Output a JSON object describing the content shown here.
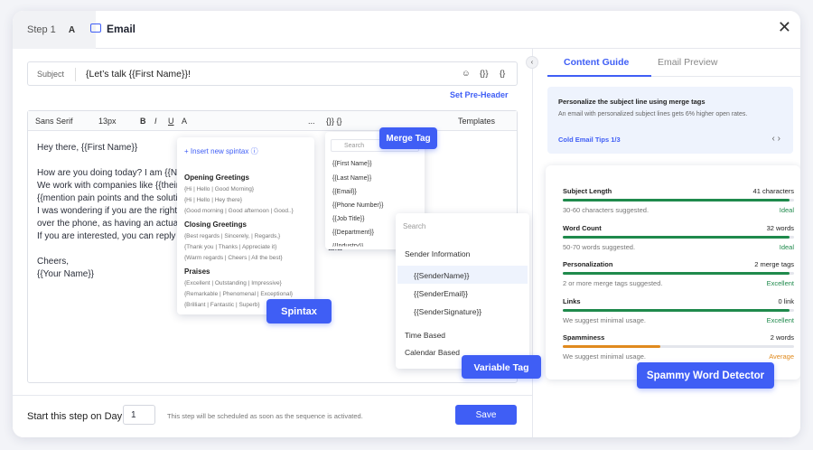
{
  "header": {
    "step": "Step 1",
    "variant": "A",
    "title": "Email",
    "close": "✕"
  },
  "subject": {
    "label": "Subject",
    "value": "{Let’s talk {{First Name}}!",
    "icons": [
      "☺",
      "{}}",
      "{}"
    ]
  },
  "preheader": "Set Pre-Header",
  "toolbar": {
    "font": "Sans Serif",
    "size": "13px",
    "bold": "B",
    "italic": "I",
    "underline": "U",
    "color": "A",
    "more": "...",
    "vars": "{}}  {}",
    "templates": "Templates"
  },
  "body": {
    "l1": "Hey there, {{First Name}}",
    "l2": "How are you doing today? I am {{Nar",
    "l3": "We work with companies like {{their c",
    "l4": "{{mention pain points and the solutio",
    "l5": "I was wondering if you are the right p",
    "l6": "over the phone, as having an actual c",
    "l7": "If you are interested, you can reply to",
    "l8": "Cheers,",
    "l9": "{{Your Name}}",
    "r5": "ope",
    "r7": "aila"
  },
  "footer": {
    "label": "Start this step on Day",
    "day": "1",
    "note": "This step will be scheduled as soon as the sequence is activated.",
    "save": "Save"
  },
  "tabs": {
    "guide": "Content Guide",
    "preview": "Email Preview"
  },
  "tip": {
    "title": "Personalize the subject line using merge tags",
    "text": "An email with personalized subject lines gets 6% higher open rates.",
    "link": "Cold Email Tips  1/3",
    "nav": "‹   ›"
  },
  "metrics": [
    {
      "name": "Subject Length",
      "value": "41 characters",
      "sub": "30-60 characters suggested.",
      "status": "Ideal",
      "level": 0.98,
      "color": "#1f8a4c"
    },
    {
      "name": "Word Count",
      "value": "32 words",
      "sub": "50-70 words suggested.",
      "status": "Ideal",
      "level": 0.98,
      "color": "#1f8a4c"
    },
    {
      "name": "Personalization",
      "value": "2 merge tags",
      "sub": "2 or more merge tags suggested.",
      "status": "Excellent",
      "level": 0.98,
      "color": "#1f8a4c"
    },
    {
      "name": "Links",
      "value": "0 link",
      "sub": "We suggest minimal usage.",
      "status": "Excellent",
      "level": 0.98,
      "color": "#1f8a4c"
    },
    {
      "name": "Spamminess",
      "value": "2 words",
      "sub": "We suggest minimal usage.",
      "status": "Average",
      "level": 0.42,
      "color": "#e08a1e"
    }
  ],
  "spintax": {
    "insert": "+  Insert new spintax  ⓘ",
    "s1": "Opening Greetings",
    "i1": "{Hi | Hello | Good Morning}",
    "i2": "{Hi | Hello | Hey there}",
    "i3": "{Good morning | Good afternoon | Good..}",
    "s2": "Closing Greetings",
    "i4": "{Best regards | Sincerely, | Regards,}",
    "i5": "{Thank you | Thanks | Appreciate it}",
    "i6": "{Warm regards | Cheers | All the best}",
    "s3": "Praises",
    "i7": "{Excellent | Outstanding | Impressive}",
    "i8": "{Remarkable | Phenomenal | Exceptional}",
    "i9": "{Brilliant | Fantastic | Superb}"
  },
  "merge": {
    "search": "Search",
    "items": [
      "{{First Name}}",
      "{{Last Name}}",
      "{{Email}}",
      "{{Phone Number}}",
      "{{Job Title}}",
      "{{Department}}",
      "{{Industry}}"
    ]
  },
  "vartag": {
    "search": "Search",
    "h1": "Sender Information",
    "a": "{{SenderName}}",
    "b": "{{SenderEmail}}",
    "c": "{{SenderSignature}}",
    "h2": "Time Based",
    "h3": "Calendar Based"
  },
  "badges": {
    "merge": "Merge Tag",
    "spintax": "Spintax",
    "variable": "Variable Tag",
    "spammy": "Spammy Word Detector"
  },
  "accent": "#3f5ef5"
}
